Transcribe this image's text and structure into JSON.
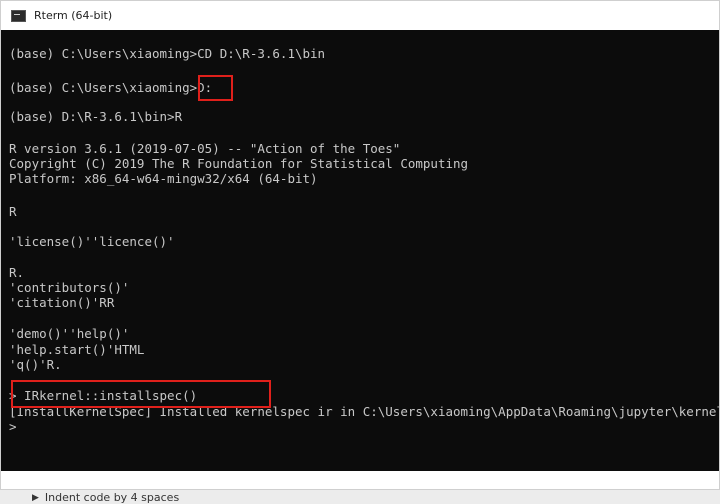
{
  "window": {
    "title": "Rterm (64-bit)"
  },
  "console": {
    "lines": [
      "(base) C:\\Users\\xiaoming>CD D:\\R-3.6.1\\bin",
      "(base) C:\\Users\\xiaoming>D:",
      "(base) D:\\R-3.6.1\\bin>R",
      "R version 3.6.1 (2019-07-05) -- \"Action of the Toes\"",
      "Copyright (C) 2019 The R Foundation for Statistical Computing",
      "Platform: x86_64-w64-mingw32/x64 (64-bit)",
      "R",
      "'license()''licence()'",
      "R.",
      "'contributors()'",
      "'citation()'RR",
      "'demo()''help()'",
      "'help.start()'HTML",
      "'q()'R.",
      "> IRkernel::installspec()",
      "[InstallKernelSpec] Installed kernelspec ir in C:\\Users\\xiaoming\\AppData\\Roaming\\jupyter\\kernels\\ir",
      ">"
    ]
  },
  "bottom": {
    "item_label": "Indent code by 4 spaces"
  },
  "colors": {
    "highlight": "#e0201b",
    "console_bg": "#0c0c0c",
    "console_fg": "#c8c8c8"
  }
}
